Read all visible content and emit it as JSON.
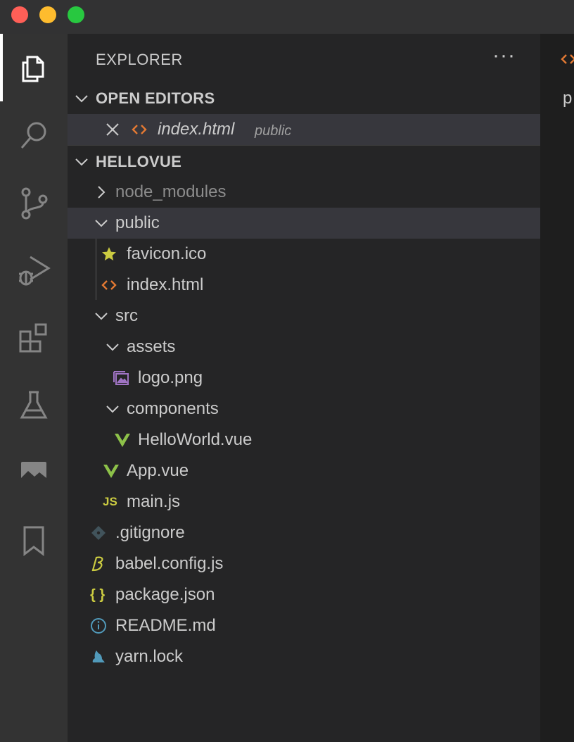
{
  "window": {
    "controls": [
      "close",
      "minimize",
      "zoom"
    ]
  },
  "activity_bar": {
    "items": [
      {
        "icon": "files-icon",
        "active": true
      },
      {
        "icon": "search-icon",
        "active": false
      },
      {
        "icon": "source-control-icon",
        "active": false
      },
      {
        "icon": "run-debug-icon",
        "active": false
      },
      {
        "icon": "extensions-icon",
        "active": false
      },
      {
        "icon": "testing-icon",
        "active": false
      },
      {
        "icon": "image-preview-icon",
        "active": false
      },
      {
        "icon": "bookmark-icon",
        "active": false
      }
    ]
  },
  "sidebar": {
    "title": "EXPLORER",
    "more_label": "···",
    "open_editors": {
      "header": "OPEN EDITORS",
      "items": [
        {
          "name": "index.html",
          "description": "public",
          "icon": "html-icon"
        }
      ]
    },
    "project": {
      "header": "HELLOVUE",
      "tree": [
        {
          "name": "node_modules",
          "type": "folder",
          "expanded": false
        },
        {
          "name": "public",
          "type": "folder",
          "expanded": true
        },
        {
          "name": "favicon.ico",
          "type": "file",
          "icon": "star-icon"
        },
        {
          "name": "index.html",
          "type": "file",
          "icon": "html-icon"
        },
        {
          "name": "src",
          "type": "folder",
          "expanded": true
        },
        {
          "name": "assets",
          "type": "folder",
          "expanded": true
        },
        {
          "name": "logo.png",
          "type": "file",
          "icon": "image-file-icon"
        },
        {
          "name": "components",
          "type": "folder",
          "expanded": true
        },
        {
          "name": "HelloWorld.vue",
          "type": "file",
          "icon": "vue-icon"
        },
        {
          "name": "App.vue",
          "type": "file",
          "icon": "vue-icon"
        },
        {
          "name": "main.js",
          "type": "file",
          "icon": "js-icon",
          "icon_text": "JS"
        },
        {
          "name": ".gitignore",
          "type": "file",
          "icon": "git-icon"
        },
        {
          "name": "babel.config.js",
          "type": "file",
          "icon": "babel-icon"
        },
        {
          "name": "package.json",
          "type": "file",
          "icon": "json-icon",
          "icon_text": "{ }"
        },
        {
          "name": "README.md",
          "type": "file",
          "icon": "info-icon"
        },
        {
          "name": "yarn.lock",
          "type": "file",
          "icon": "yarn-icon"
        }
      ]
    }
  },
  "editor": {
    "tab_icon": "html-icon",
    "breadcrumb_partial": "p"
  },
  "colors": {
    "html": "#e37933",
    "star": "#cbcb41",
    "vue": "#8dc149",
    "js": "#cbcb41",
    "image": "#a074c4",
    "info": "#519aba",
    "git": "#41535b",
    "folder_dim": "#8c8c8c"
  }
}
